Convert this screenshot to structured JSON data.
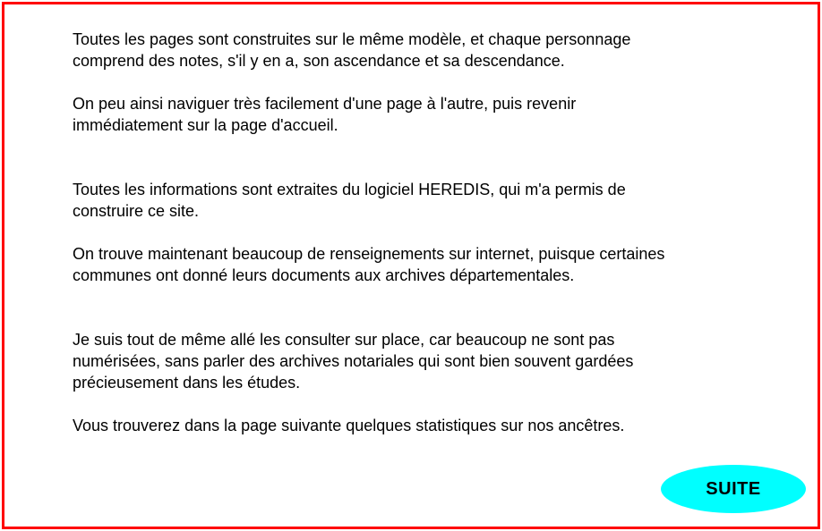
{
  "paragraphs": [
    "Toutes les pages sont construites sur le même modèle, et chaque personnage\ncomprend des notes, s'il y en a, son ascendance et sa descendance.",
    "On peu ainsi naviguer très facilement d'une page à l'autre, puis revenir\nimmédiatement sur la page d'accueil.",
    "Toutes les informations sont extraites du logiciel HEREDIS, qui m'a permis de\nconstruire ce site.",
    "On trouve maintenant beaucoup de renseignements sur internet, puisque certaines\ncommunes ont donné leurs documents aux archives départementales.",
    "Je suis tout de même allé les consulter sur place, car beaucoup ne sont pas\nnumérisées, sans parler des archives notariales qui sont bien souvent gardées\nprécieusement dans les études.",
    "Vous trouverez dans la page suivante quelques statistiques sur nos ancêtres."
  ],
  "nav": {
    "next_label": "SUITE"
  },
  "colors": {
    "frame_border": "#ff0000",
    "button_fill": "#00ffff",
    "text": "#000000",
    "background": "#ffffff"
  }
}
